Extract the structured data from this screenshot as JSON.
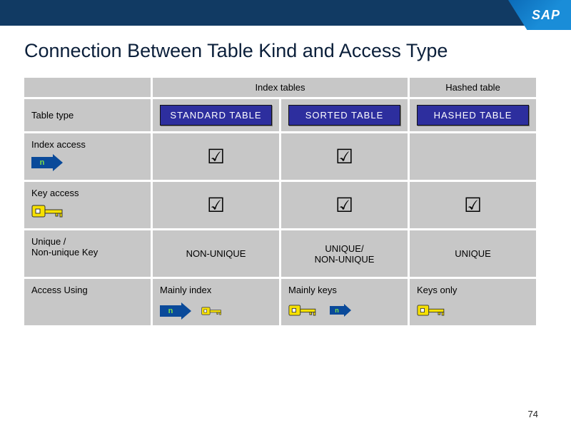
{
  "brand": "SAP",
  "title": "Connection Between Table Kind and Access Type",
  "groupHeaders": {
    "index": "Index tables",
    "hashed": "Hashed table"
  },
  "rows": {
    "tableType": {
      "label": "Table type",
      "standard": "STANDARD TABLE",
      "sorted": "SORTED TABLE",
      "hashed": "HASHED TABLE"
    },
    "indexAccess": {
      "label": "Index access",
      "standard": "☑",
      "sorted": "☑",
      "hashed": ""
    },
    "keyAccess": {
      "label": "Key access",
      "standard": "☑",
      "sorted": "☑",
      "hashed": "☑"
    },
    "unique": {
      "label": "Unique /\nNon-unique Key",
      "standard": "NON-UNIQUE",
      "sorted": "UNIQUE/\nNON-UNIQUE",
      "hashed": "UNIQUE"
    },
    "accessUsing": {
      "label": "Access Using",
      "standard": "Mainly index",
      "sorted": "Mainly keys",
      "hashed": "Keys only"
    }
  },
  "arrowLabel": "n",
  "pageNumber": "74"
}
